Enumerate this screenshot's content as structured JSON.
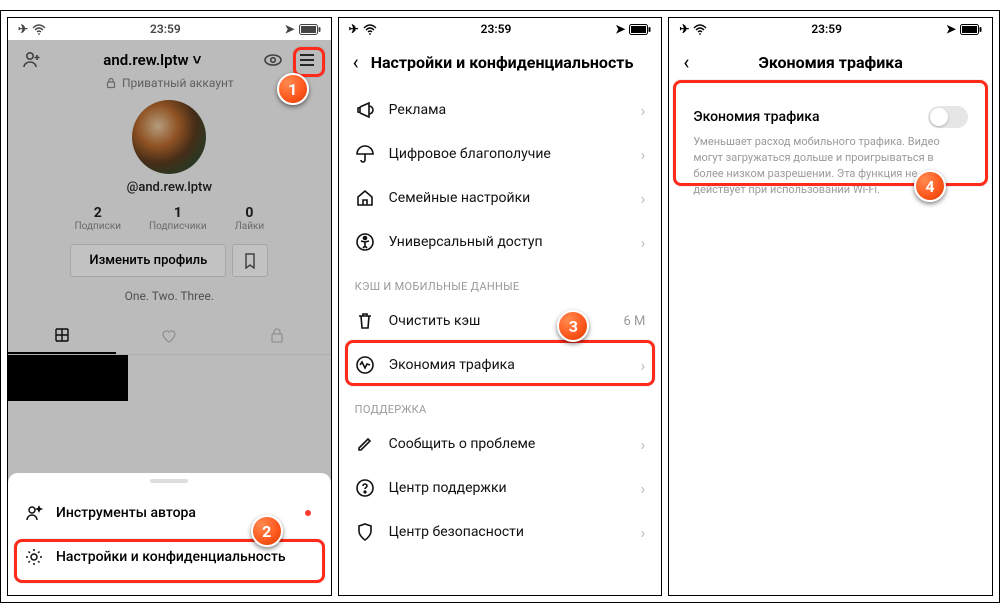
{
  "status": {
    "time": "23:59"
  },
  "screen1": {
    "username": "and.rew.lptw",
    "private_label": "Приватный аккаунт",
    "handle": "@and.rew.lptw",
    "stats": {
      "following": {
        "num": "2",
        "label": "Подписки"
      },
      "followers": {
        "num": "1",
        "label": "Подписчики"
      },
      "likes": {
        "num": "0",
        "label": "Лайки"
      }
    },
    "edit_label": "Изменить профиль",
    "bio": "One. Two. Three.",
    "sheet": {
      "author_tools": "Инструменты автора",
      "settings": "Настройки и конфиденциальность"
    },
    "badges": {
      "menu": "1",
      "settings": "2"
    }
  },
  "screen2": {
    "title": "Настройки и конфиденциальность",
    "items": {
      "ads": "Реклама",
      "wellbeing": "Цифровое благополучие",
      "family": "Семейные настройки",
      "accessibility": "Универсальный доступ"
    },
    "section_cache": "КЭШ И МОБИЛЬНЫЕ ДАННЫЕ",
    "cache_items": {
      "clear": "Очистить кэш",
      "clear_value": "6 M",
      "data_saver": "Экономия трафика"
    },
    "section_support": "ПОДДЕРЖКА",
    "support_items": {
      "report": "Сообщить о проблеме",
      "help": "Центр поддержки",
      "safety": "Центр безопасности"
    },
    "badge": "3"
  },
  "screen3": {
    "title": "Экономия трафика",
    "toggle_label": "Экономия трафика",
    "toggle_desc": "Уменьшает расход мобильного трафика. Видео могут загружаться дольше и проигрываться в более низком разрешении. Эта функция не действует при использовании Wi-Fi.",
    "badge": "4"
  }
}
